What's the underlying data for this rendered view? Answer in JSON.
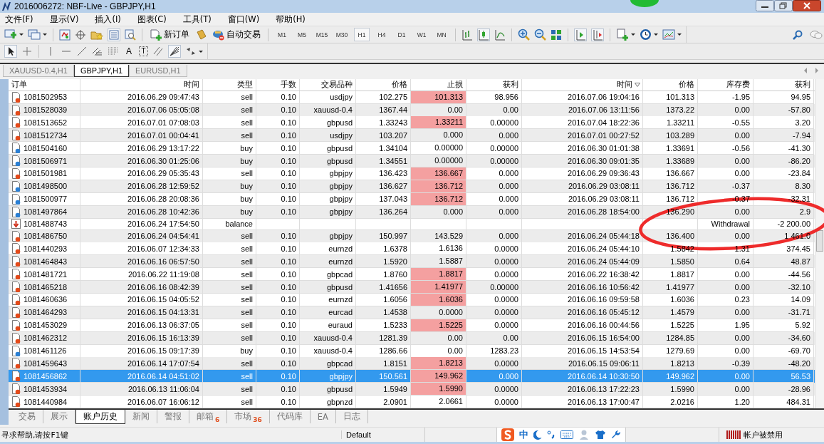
{
  "window": {
    "title": "2016006272: NBF-Live - GBPJPY,H1"
  },
  "menu": [
    "文件(F)",
    "显示(V)",
    "插入(I)",
    "图表(C)",
    "工具(T)",
    "窗口(W)",
    "帮助(H)"
  ],
  "toolbar": {
    "new_order": "新订单",
    "auto_trading": "自动交易",
    "timeframes": [
      {
        "label": "M1",
        "selected": false
      },
      {
        "label": "M5",
        "selected": false
      },
      {
        "label": "M15",
        "selected": false
      },
      {
        "label": "M30",
        "selected": false
      },
      {
        "label": "H1",
        "selected": true
      },
      {
        "label": "H4",
        "selected": false
      },
      {
        "label": "D1",
        "selected": false
      },
      {
        "label": "W1",
        "selected": false
      },
      {
        "label": "MN",
        "selected": false
      }
    ]
  },
  "drawing_tools": {
    "text_tool": "A",
    "text_label_tool": "T"
  },
  "chart_tabs": [
    {
      "label": "XAUUSD-0.4,H1",
      "selected": false
    },
    {
      "label": "GBPJPY,H1",
      "selected": true
    },
    {
      "label": "EURUSD,H1",
      "selected": false
    }
  ],
  "table": {
    "columns": [
      {
        "label": "订单",
        "sorted": false
      },
      {
        "label": "时间",
        "sorted": false
      },
      {
        "label": "类型",
        "sorted": false
      },
      {
        "label": "手数",
        "sorted": false
      },
      {
        "label": "交易品种",
        "sorted": false
      },
      {
        "label": "价格",
        "sorted": false
      },
      {
        "label": "止损",
        "sorted": false
      },
      {
        "label": "获利",
        "sorted": false
      },
      {
        "label": "时间",
        "sorted": true
      },
      {
        "label": "价格",
        "sorted": false
      },
      {
        "label": "库存费",
        "sorted": false
      },
      {
        "label": "获利",
        "sorted": false
      }
    ],
    "rows": [
      {
        "kind": "sell",
        "order": "1081502953",
        "open_time": "2016.06.29 09:47:43",
        "type": "sell",
        "lots": "0.10",
        "symbol": "usdjpy",
        "open_price": "102.275",
        "sl": "101.313",
        "sl_hit": true,
        "tp": "98.956",
        "close_time": "2016.07.06 19:04:16",
        "close_price": "101.313",
        "swap": "-1.95",
        "profit": "94.95",
        "selected": false
      },
      {
        "kind": "sell",
        "order": "1081528039",
        "open_time": "2016.07.06 05:05:08",
        "type": "sell",
        "lots": "0.10",
        "symbol": "xauusd-0.4",
        "open_price": "1367.44",
        "sl": "0.00",
        "sl_hit": false,
        "tp": "0.00",
        "close_time": "2016.07.06 13:11:56",
        "close_price": "1373.22",
        "swap": "0.00",
        "profit": "-57.80",
        "selected": false
      },
      {
        "kind": "sell",
        "order": "1081513652",
        "open_time": "2016.07.01 07:08:03",
        "type": "sell",
        "lots": "0.10",
        "symbol": "gbpusd",
        "open_price": "1.33243",
        "sl": "1.33211",
        "sl_hit": true,
        "tp": "0.00000",
        "close_time": "2016.07.04 18:22:36",
        "close_price": "1.33211",
        "swap": "-0.55",
        "profit": "3.20",
        "selected": false
      },
      {
        "kind": "sell",
        "order": "1081512734",
        "open_time": "2016.07.01 00:04:41",
        "type": "sell",
        "lots": "0.10",
        "symbol": "usdjpy",
        "open_price": "103.207",
        "sl": "0.000",
        "sl_hit": false,
        "tp": "0.000",
        "close_time": "2016.07.01 00:27:52",
        "close_price": "103.289",
        "swap": "0.00",
        "profit": "-7.94",
        "selected": false
      },
      {
        "kind": "buy",
        "order": "1081504160",
        "open_time": "2016.06.29 13:17:22",
        "type": "buy",
        "lots": "0.10",
        "symbol": "gbpusd",
        "open_price": "1.34104",
        "sl": "0.00000",
        "sl_hit": false,
        "tp": "0.00000",
        "close_time": "2016.06.30 01:01:38",
        "close_price": "1.33691",
        "swap": "-0.56",
        "profit": "-41.30",
        "selected": false
      },
      {
        "kind": "buy",
        "order": "1081506971",
        "open_time": "2016.06.30 01:25:06",
        "type": "buy",
        "lots": "0.10",
        "symbol": "gbpusd",
        "open_price": "1.34551",
        "sl": "0.00000",
        "sl_hit": false,
        "tp": "0.00000",
        "close_time": "2016.06.30 09:01:35",
        "close_price": "1.33689",
        "swap": "0.00",
        "profit": "-86.20",
        "selected": false
      },
      {
        "kind": "sell",
        "order": "1081501981",
        "open_time": "2016.06.29 05:35:43",
        "type": "sell",
        "lots": "0.10",
        "symbol": "gbpjpy",
        "open_price": "136.423",
        "sl": "136.667",
        "sl_hit": true,
        "tp": "0.000",
        "close_time": "2016.06.29 09:36:43",
        "close_price": "136.667",
        "swap": "0.00",
        "profit": "-23.84",
        "selected": false
      },
      {
        "kind": "buy",
        "order": "1081498500",
        "open_time": "2016.06.28 12:59:52",
        "type": "buy",
        "lots": "0.10",
        "symbol": "gbpjpy",
        "open_price": "136.627",
        "sl": "136.712",
        "sl_hit": true,
        "tp": "0.000",
        "close_time": "2016.06.29 03:08:11",
        "close_price": "136.712",
        "swap": "-0.37",
        "profit": "8.30",
        "selected": false
      },
      {
        "kind": "buy",
        "order": "1081500977",
        "open_time": "2016.06.28 20:08:36",
        "type": "buy",
        "lots": "0.10",
        "symbol": "gbpjpy",
        "open_price": "137.043",
        "sl": "136.712",
        "sl_hit": true,
        "tp": "0.000",
        "close_time": "2016.06.29 03:08:11",
        "close_price": "136.712",
        "swap": "-0.37",
        "profit": "-32.31",
        "selected": false
      },
      {
        "kind": "buy",
        "order": "1081497864",
        "open_time": "2016.06.28 10:42:36",
        "type": "buy",
        "lots": "0.10",
        "symbol": "gbpjpy",
        "open_price": "136.264",
        "sl": "0.000",
        "sl_hit": false,
        "tp": "0.000",
        "close_time": "2016.06.28 18:54:00",
        "close_price": "136.290",
        "swap": "0.00",
        "profit": "2.9",
        "selected": false
      },
      {
        "kind": "balance",
        "order": "1081488743",
        "open_time": "2016.06.24 17:54:50",
        "type": "balance",
        "comment": "Withdrawal",
        "profit": "-2 200.00",
        "selected": false
      },
      {
        "kind": "sell",
        "order": "1081486750",
        "open_time": "2016.06.24 04:54:41",
        "type": "sell",
        "lots": "0.10",
        "symbol": "gbpjpy",
        "open_price": "150.997",
        "sl": "143.529",
        "sl_hit": false,
        "tp": "0.000",
        "close_time": "2016.06.24 05:44:18",
        "close_price": "136.400",
        "swap": "0.00",
        "profit": "1 461.0",
        "selected": false
      },
      {
        "kind": "sell",
        "order": "1081440293",
        "open_time": "2016.06.07 12:34:33",
        "type": "sell",
        "lots": "0.10",
        "symbol": "eurnzd",
        "open_price": "1.6378",
        "sl": "1.6136",
        "sl_hit": false,
        "tp": "0.0000",
        "close_time": "2016.06.24 05:44:10",
        "close_price": "1.5842",
        "swap": "1.31",
        "profit": "374.45",
        "selected": false
      },
      {
        "kind": "sell",
        "order": "1081464843",
        "open_time": "2016.06.16 06:57:50",
        "type": "sell",
        "lots": "0.10",
        "symbol": "eurnzd",
        "open_price": "1.5920",
        "sl": "1.5887",
        "sl_hit": false,
        "tp": "0.0000",
        "close_time": "2016.06.24 05:44:09",
        "close_price": "1.5850",
        "swap": "0.64",
        "profit": "48.87",
        "selected": false
      },
      {
        "kind": "sell",
        "order": "1081481721",
        "open_time": "2016.06.22 11:19:08",
        "type": "sell",
        "lots": "0.10",
        "symbol": "gbpcad",
        "open_price": "1.8760",
        "sl": "1.8817",
        "sl_hit": true,
        "tp": "0.0000",
        "close_time": "2016.06.22 16:38:42",
        "close_price": "1.8817",
        "swap": "0.00",
        "profit": "-44.56",
        "selected": false
      },
      {
        "kind": "sell",
        "order": "1081465218",
        "open_time": "2016.06.16 08:42:39",
        "type": "sell",
        "lots": "0.10",
        "symbol": "gbpusd",
        "open_price": "1.41656",
        "sl": "1.41977",
        "sl_hit": true,
        "tp": "0.00000",
        "close_time": "2016.06.16 10:56:42",
        "close_price": "1.41977",
        "swap": "0.00",
        "profit": "-32.10",
        "selected": false
      },
      {
        "kind": "sell",
        "order": "1081460636",
        "open_time": "2016.06.15 04:05:52",
        "type": "sell",
        "lots": "0.10",
        "symbol": "eurnzd",
        "open_price": "1.6056",
        "sl": "1.6036",
        "sl_hit": true,
        "tp": "0.0000",
        "close_time": "2016.06.16 09:59:58",
        "close_price": "1.6036",
        "swap": "0.23",
        "profit": "14.09",
        "selected": false
      },
      {
        "kind": "sell",
        "order": "1081464293",
        "open_time": "2016.06.15 04:13:31",
        "type": "sell",
        "lots": "0.10",
        "symbol": "eurcad",
        "open_price": "1.4538",
        "sl": "0.0000",
        "sl_hit": false,
        "tp": "0.0000",
        "close_time": "2016.06.16 05:45:12",
        "close_price": "1.4579",
        "swap": "0.00",
        "profit": "-31.71",
        "selected": false
      },
      {
        "kind": "sell",
        "order": "1081453029",
        "open_time": "2016.06.13 06:37:05",
        "type": "sell",
        "lots": "0.10",
        "symbol": "euraud",
        "open_price": "1.5233",
        "sl": "1.5225",
        "sl_hit": true,
        "tp": "0.0000",
        "close_time": "2016.06.16 00:44:56",
        "close_price": "1.5225",
        "swap": "1.95",
        "profit": "5.92",
        "selected": false
      },
      {
        "kind": "sell",
        "order": "1081462312",
        "open_time": "2016.06.15 16:13:39",
        "type": "sell",
        "lots": "0.10",
        "symbol": "xauusd-0.4",
        "open_price": "1281.39",
        "sl": "0.00",
        "sl_hit": false,
        "tp": "0.00",
        "close_time": "2016.06.15 16:54:00",
        "close_price": "1284.85",
        "swap": "0.00",
        "profit": "-34.60",
        "selected": false
      },
      {
        "kind": "buy",
        "order": "1081461126",
        "open_time": "2016.06.15 09:17:39",
        "type": "buy",
        "lots": "0.10",
        "symbol": "xauusd-0.4",
        "open_price": "1286.66",
        "sl": "0.00",
        "sl_hit": false,
        "tp": "1283.23",
        "close_time": "2016.06.15 14:53:54",
        "close_price": "1279.69",
        "swap": "0.00",
        "profit": "-69.70",
        "selected": false
      },
      {
        "kind": "sell",
        "order": "1081459643",
        "open_time": "2016.06.14 17:07:54",
        "type": "sell",
        "lots": "0.10",
        "symbol": "gbpcad",
        "open_price": "1.8151",
        "sl": "1.8213",
        "sl_hit": true,
        "tp": "0.0000",
        "close_time": "2016.06.15 09:06:11",
        "close_price": "1.8213",
        "swap": "-0.39",
        "profit": "-48.20",
        "selected": false
      },
      {
        "kind": "sell",
        "order": "1081456862",
        "open_time": "2016.06.14 04:51:02",
        "type": "sell",
        "lots": "0.10",
        "symbol": "gbpjpy",
        "open_price": "150.561",
        "sl": "149.962",
        "sl_hit": true,
        "tp": "0.000",
        "close_time": "2016.06.14 10:30:50",
        "close_price": "149.962",
        "swap": "0.00",
        "profit": "56.53",
        "selected": true
      },
      {
        "kind": "sell",
        "order": "1081453934",
        "open_time": "2016.06.13 11:06:04",
        "type": "sell",
        "lots": "0.10",
        "symbol": "gbpusd",
        "open_price": "1.5949",
        "sl": "1.5990",
        "sl_hit": true,
        "tp": "0.0000",
        "close_time": "2016.06.13 17:22:23",
        "close_price": "1.5990",
        "swap": "0.00",
        "profit": "-28.96",
        "selected": false
      },
      {
        "kind": "sell",
        "order": "1081440984",
        "open_time": "2016.06.07 16:06:12",
        "type": "sell",
        "lots": "0.10",
        "symbol": "gbpnzd",
        "open_price": "2.0901",
        "sl": "2.0661",
        "sl_hit": false,
        "tp": "0.0000",
        "close_time": "2016.06.13 17:00:47",
        "close_price": "2.0216",
        "swap": "1.20",
        "profit": "484.31",
        "selected": false
      }
    ]
  },
  "bottom_tabs": [
    {
      "label": "交易",
      "selected": false
    },
    {
      "label": "展示",
      "selected": false
    },
    {
      "label": "账户历史",
      "selected": true
    },
    {
      "label": "新闻",
      "selected": false
    },
    {
      "label": "警报",
      "selected": false
    },
    {
      "label": "邮箱",
      "badge": "6",
      "selected": false
    },
    {
      "label": "市场",
      "badge": "36",
      "selected": false
    },
    {
      "label": "代码库",
      "selected": false
    },
    {
      "label": "EA",
      "selected": false
    },
    {
      "label": "日志",
      "selected": false
    }
  ],
  "status_bar": {
    "help": "寻求帮助,请按F1键",
    "profile": "Default",
    "ime_mode": "中",
    "account": "帐户被禁用"
  },
  "annotations": [
    {
      "kind": "ellipse"
    }
  ]
}
